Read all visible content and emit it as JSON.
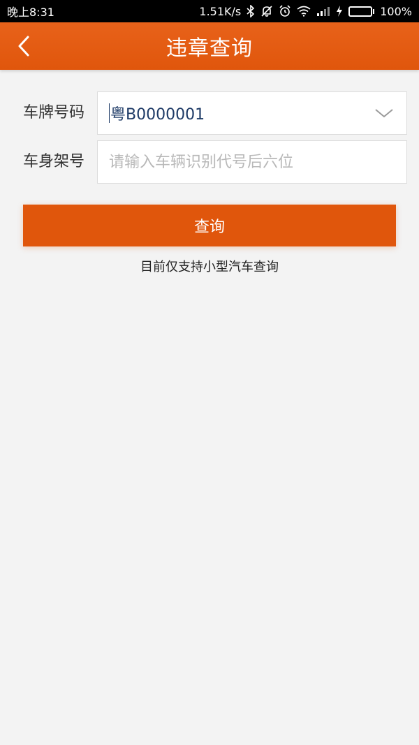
{
  "status_bar": {
    "time": "晚上8:31",
    "network_speed": "1.51K/s",
    "battery_percent": "100%",
    "battery_level": 1.0
  },
  "app_bar": {
    "title": "违章查询",
    "back_icon": "chevron-left-icon"
  },
  "form": {
    "plate": {
      "label": "车牌号码",
      "value": "粤B0000001",
      "dropdown_icon": "chevron-down-icon"
    },
    "vin": {
      "label": "车身架号",
      "placeholder": "请输入车辆识别代号后六位",
      "value": ""
    }
  },
  "actions": {
    "query_label": "查询"
  },
  "note": "目前仅支持小型汽车查询",
  "colors": {
    "accent": "#e0560c",
    "background": "#f3f3f3",
    "input_text": "#1d3a66"
  }
}
